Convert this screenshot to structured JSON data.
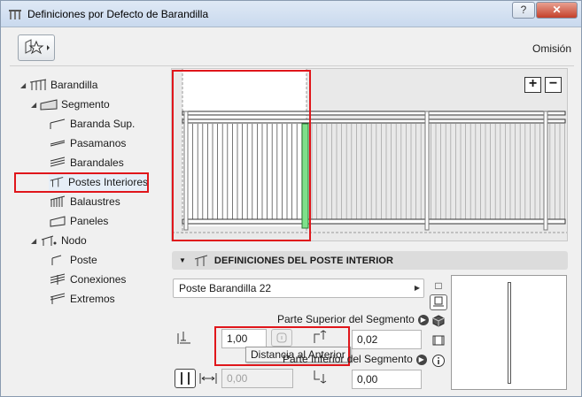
{
  "window": {
    "title": "Definiciones por Defecto de Barandilla",
    "help_label": "?",
    "close_label": "✕"
  },
  "toolbar": {
    "favorites_icon": "favorites-star-icon",
    "omision_label": "Omisión"
  },
  "tree": {
    "items": [
      {
        "label": "Barandilla",
        "icon": "railing-icon"
      },
      {
        "label": "Segmento",
        "icon": "segment-icon"
      },
      {
        "label": "Baranda Sup.",
        "icon": "top-rail-icon"
      },
      {
        "label": "Pasamanos",
        "icon": "handrail-icon"
      },
      {
        "label": "Barandales",
        "icon": "rails-icon"
      },
      {
        "label": "Postes Interiores",
        "icon": "inner-post-icon"
      },
      {
        "label": "Balaustres",
        "icon": "balusters-icon"
      },
      {
        "label": "Paneles",
        "icon": "panels-icon"
      },
      {
        "label": "Nodo",
        "icon": "node-icon"
      },
      {
        "label": "Poste",
        "icon": "post-icon"
      },
      {
        "label": "Conexiones",
        "icon": "connections-icon"
      },
      {
        "label": "Extremos",
        "icon": "ends-icon"
      }
    ],
    "selected": "Postes Interiores"
  },
  "preview": {
    "zoom_in": "+",
    "zoom_out": "−"
  },
  "section": {
    "title": "DEFINICIONES DEL POSTE INTERIOR"
  },
  "post_type": {
    "value": "Poste Barandilla 22"
  },
  "top_of_segment": {
    "label": "Parte Superior del Segmento",
    "distance_value": "1,00",
    "offset_value": "0,02"
  },
  "bottom_of_segment": {
    "label": "Parte Inferior del Segmento",
    "distance_value": "0,00",
    "offset_value": "0,00"
  },
  "tooltip": {
    "text": "Distancia al Anterior"
  },
  "colors": {
    "highlight": "#e0161b",
    "selected_post": "#7fe08a"
  }
}
